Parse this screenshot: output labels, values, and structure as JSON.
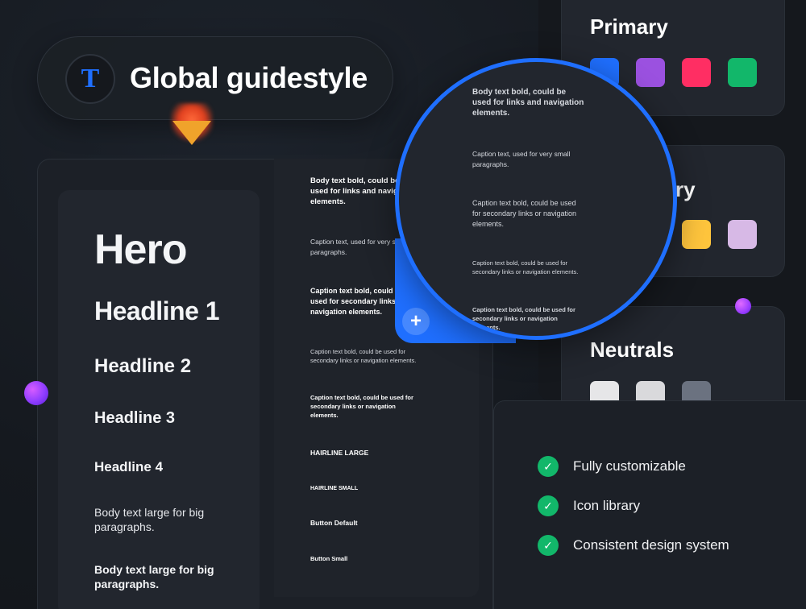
{
  "header": {
    "logo_letter": "T",
    "title": "Global guidestyle"
  },
  "type_scale": {
    "hero": "Hero",
    "h1": "Headline 1",
    "h2": "Headline 2",
    "h3": "Headline 3",
    "h4": "Headline 4",
    "body_large": "Body text large for big paragraphs.",
    "body_large_bold": "Body text large for big paragraphs."
  },
  "text_styles": {
    "body_bold": "Body text bold, could be used for links and navigation elements.",
    "caption": "Caption text, used for very small paragraphs.",
    "caption_bold": "Caption text bold, could be used for secondary links or navigation elements.",
    "caption_bold_small": "Caption text bold, could be used for secondary links or navigation elements.",
    "caption_bold_strong": "Caption text bold, could be used for secondary links or navigation elements.",
    "hairline_large": "HAIRLINE LARGE",
    "hairline_small": "HAIRLINE SMALL",
    "button_default": "Button Default",
    "button_small": "Button Small"
  },
  "text_col_visible": {
    "body_bold": "Body text bold, could be used for links and navigation elements.",
    "caption": "Caption text, used for very small paragraphs.",
    "caption_bold": "Caption text bold, could be used for secondary links or navigation elements."
  },
  "colors": {
    "primary_title": "Primary",
    "secondary_title_fragment": "ry",
    "neutrals_title": "Neutrals",
    "primary": [
      "#1f6fff",
      "#9b51e0",
      "#ff2e63",
      "#12b76a"
    ],
    "secondary": [
      "#ffc53d",
      "#d7b9e6"
    ],
    "neutrals": [
      "#e6e6e8",
      "#d9d9dc",
      "#6b7280"
    ]
  },
  "features": [
    "Fully customizable",
    "Icon library",
    "Consistent design system"
  ],
  "magnifier": {
    "plus": "+"
  }
}
